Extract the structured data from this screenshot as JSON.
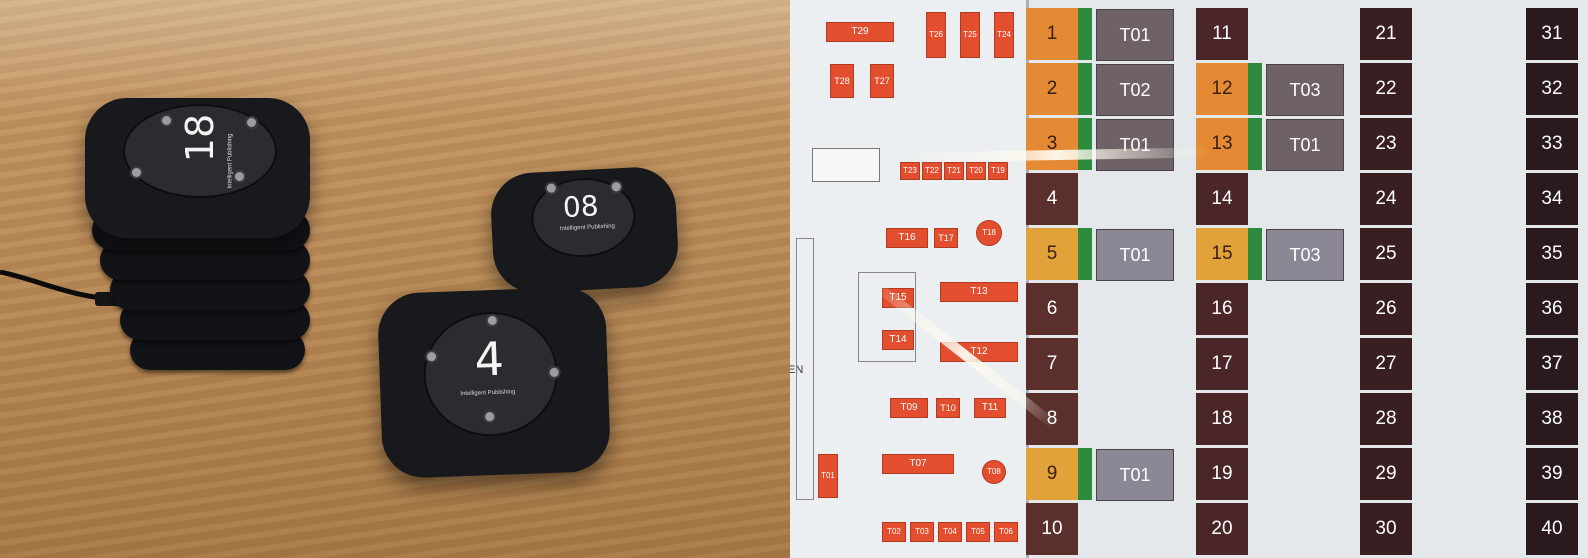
{
  "photo": {
    "pagers": [
      {
        "number": "18",
        "brand": "Intelligent Publishing"
      },
      {
        "number": "08",
        "brand": "Intelligent Publishing"
      },
      {
        "number": "4",
        "brand": "Intelligent Publishing"
      }
    ]
  },
  "floor_map": {
    "tables": [
      "T29",
      "T26",
      "T25",
      "T24",
      "T28",
      "T27",
      "T23",
      "T22",
      "T21",
      "T20",
      "T19",
      "T16",
      "T17",
      "T18",
      "T15",
      "T13",
      "T14",
      "T12",
      "T09",
      "T10",
      "T11",
      "T07",
      "T08",
      "T01",
      "T02",
      "T03",
      "T04",
      "T05",
      "T06"
    ],
    "side_label": "EN"
  },
  "pager_board": {
    "columns": [
      {
        "numbers": [
          "1",
          "2",
          "3",
          "4",
          "5",
          "6",
          "7",
          "8",
          "9",
          "10"
        ]
      },
      {
        "numbers": [
          "11",
          "12",
          "13",
          "14",
          "15",
          "16",
          "17",
          "18",
          "19",
          "20"
        ]
      },
      {
        "numbers": [
          "21",
          "22",
          "23",
          "24",
          "25",
          "26",
          "27",
          "28",
          "29",
          "30"
        ]
      },
      {
        "numbers": [
          "31",
          "32",
          "33",
          "34",
          "35",
          "36",
          "37",
          "38",
          "39",
          "40"
        ]
      }
    ],
    "assignments": [
      {
        "pager": "1",
        "table": "T01"
      },
      {
        "pager": "2",
        "table": "T02"
      },
      {
        "pager": "3",
        "table": "T01"
      },
      {
        "pager": "5",
        "table": "T01"
      },
      {
        "pager": "9",
        "table": "T01"
      },
      {
        "pager": "12",
        "table": "T03"
      },
      {
        "pager": "13",
        "table": "T01"
      },
      {
        "pager": "15",
        "table": "T03"
      }
    ],
    "colors": {
      "active_orange": "#e58a34",
      "active_amber": "#e2a23a",
      "idle_col1": "#5a2f2c",
      "idle_col2": "#4a2628",
      "idle_col3": "#3a1f22",
      "idle_col4": "#2a1a1e"
    }
  }
}
